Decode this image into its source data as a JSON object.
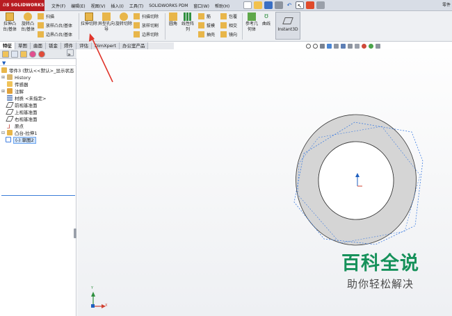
{
  "app": {
    "logo_text": "SOLIDWORKS",
    "title_fragment": "零件",
    "brand_color": "#b81c22"
  },
  "menu": [
    "文件(F)",
    "编辑(E)",
    "视图(V)",
    "插入(I)",
    "工具(T)",
    "SOLIDWORKS PDM",
    "窗口(W)",
    "帮助(H)"
  ],
  "ribbon": {
    "extrude_boss": "拉伸凸台/基体",
    "revolve_boss": "旋转凸台/基体",
    "sweep": "扫描",
    "loft_boss": "放样凸台/基体",
    "boundary_boss": "边界凸台/基体",
    "extrude_cut": "拉伸切除",
    "hole_wizard": "异型孔向导",
    "revolve_cut": "旋转切除",
    "swept_cut": "扫描切除",
    "lofted_cut": "放样切割",
    "boundary_cut": "边界切除",
    "fillet": "圆角",
    "linear_pattern": "线性阵列",
    "rib": "筋",
    "draft": "拔模",
    "shell": "抽壳",
    "wrap": "包覆",
    "intersect": "相交",
    "mirror": "镜向",
    "reference_geometry": "参考几何体",
    "curves": "曲线",
    "instant3d": "Instant3D"
  },
  "command_tabs": [
    "特征",
    "草图",
    "曲面",
    "钣金",
    "焊件",
    "评估",
    "DimXpert",
    "办公室产品"
  ],
  "active_tab": "特征",
  "feature_tree": {
    "root": "零件3 (默认<<默认>_显示状态",
    "items": [
      {
        "label": "History"
      },
      {
        "label": "传感器"
      },
      {
        "label": "注解"
      },
      {
        "label": "材质 <未指定>"
      },
      {
        "label": "前视基准面"
      },
      {
        "label": "上视基准面"
      },
      {
        "label": "右视基准面"
      },
      {
        "label": "原点"
      },
      {
        "label": "凸台-拉伸1"
      },
      {
        "label": "(-) 草图2"
      }
    ],
    "more_glyph": "»"
  },
  "triad": {
    "x_label": "X",
    "y_label": "Y"
  },
  "watermark": {
    "big": "百科全说",
    "small": "助你轻松解决"
  },
  "colors": {
    "part_fill": "#d5d5d5",
    "sketch_blue": "#3f7de0",
    "arrow_red": "#e0352b",
    "watermark_green": "#16915a"
  }
}
